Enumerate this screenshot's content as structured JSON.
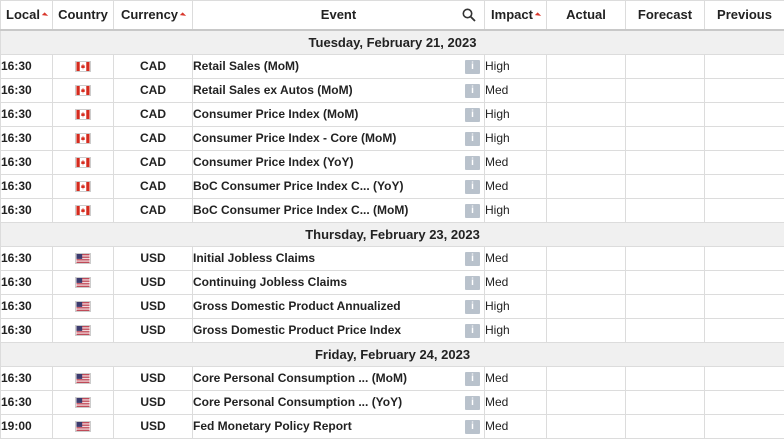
{
  "header": {
    "local": "Local",
    "country": "Country",
    "currency": "Currency",
    "event": "Event",
    "impact": "Impact",
    "actual": "Actual",
    "forecast": "Forecast",
    "previous": "Previous"
  },
  "colors": {
    "sort_arrow": "#d9362b",
    "date_row_bg": "#f0f0f0",
    "info_icon_bg": "#b9c2cc"
  },
  "groups": [
    {
      "date": "Tuesday, February 21, 2023",
      "rows": [
        {
          "time": "16:30",
          "country": "Canada",
          "flag": "ca-flag-icon",
          "currency": "CAD",
          "event": "Retail Sales (MoM)",
          "impact": "High",
          "actual": "",
          "forecast": "",
          "previous": ""
        },
        {
          "time": "16:30",
          "country": "Canada",
          "flag": "ca-flag-icon",
          "currency": "CAD",
          "event": "Retail Sales ex Autos (MoM)",
          "impact": "Med",
          "actual": "",
          "forecast": "",
          "previous": ""
        },
        {
          "time": "16:30",
          "country": "Canada",
          "flag": "ca-flag-icon",
          "currency": "CAD",
          "event": "Consumer Price Index (MoM)",
          "impact": "High",
          "actual": "",
          "forecast": "",
          "previous": ""
        },
        {
          "time": "16:30",
          "country": "Canada",
          "flag": "ca-flag-icon",
          "currency": "CAD",
          "event": "Consumer Price Index - Core (MoM)",
          "impact": "High",
          "actual": "",
          "forecast": "",
          "previous": ""
        },
        {
          "time": "16:30",
          "country": "Canada",
          "flag": "ca-flag-icon",
          "currency": "CAD",
          "event": "Consumer Price Index (YoY)",
          "impact": "Med",
          "actual": "",
          "forecast": "",
          "previous": ""
        },
        {
          "time": "16:30",
          "country": "Canada",
          "flag": "ca-flag-icon",
          "currency": "CAD",
          "event": "BoC Consumer Price Index C...  (YoY)",
          "impact": "Med",
          "actual": "",
          "forecast": "",
          "previous": ""
        },
        {
          "time": "16:30",
          "country": "Canada",
          "flag": "ca-flag-icon",
          "currency": "CAD",
          "event": "BoC Consumer Price Index C...  (MoM)",
          "impact": "High",
          "actual": "",
          "forecast": "",
          "previous": ""
        }
      ]
    },
    {
      "date": "Thursday, February 23, 2023",
      "rows": [
        {
          "time": "16:30",
          "country": "United States",
          "flag": "us-flag-icon",
          "currency": "USD",
          "event": "Initial Jobless Claims",
          "impact": "Med",
          "actual": "",
          "forecast": "",
          "previous": ""
        },
        {
          "time": "16:30",
          "country": "United States",
          "flag": "us-flag-icon",
          "currency": "USD",
          "event": "Continuing Jobless Claims",
          "impact": "Med",
          "actual": "",
          "forecast": "",
          "previous": ""
        },
        {
          "time": "16:30",
          "country": "United States",
          "flag": "us-flag-icon",
          "currency": "USD",
          "event": "Gross Domestic Product Annualized",
          "impact": "High",
          "actual": "",
          "forecast": "",
          "previous": ""
        },
        {
          "time": "16:30",
          "country": "United States",
          "flag": "us-flag-icon",
          "currency": "USD",
          "event": "Gross Domestic Product Price Index",
          "impact": "High",
          "actual": "",
          "forecast": "",
          "previous": ""
        }
      ]
    },
    {
      "date": "Friday, February 24, 2023",
      "rows": [
        {
          "time": "16:30",
          "country": "United States",
          "flag": "us-flag-icon",
          "currency": "USD",
          "event": "Core Personal Consumption ...  (MoM)",
          "impact": "Med",
          "actual": "",
          "forecast": "",
          "previous": ""
        },
        {
          "time": "16:30",
          "country": "United States",
          "flag": "us-flag-icon",
          "currency": "USD",
          "event": "Core Personal Consumption ...  (YoY)",
          "impact": "Med",
          "actual": "",
          "forecast": "",
          "previous": ""
        },
        {
          "time": "19:00",
          "country": "United States",
          "flag": "us-flag-icon",
          "currency": "USD",
          "event": "Fed Monetary Policy Report",
          "impact": "Med",
          "actual": "",
          "forecast": "",
          "previous": ""
        }
      ]
    }
  ]
}
